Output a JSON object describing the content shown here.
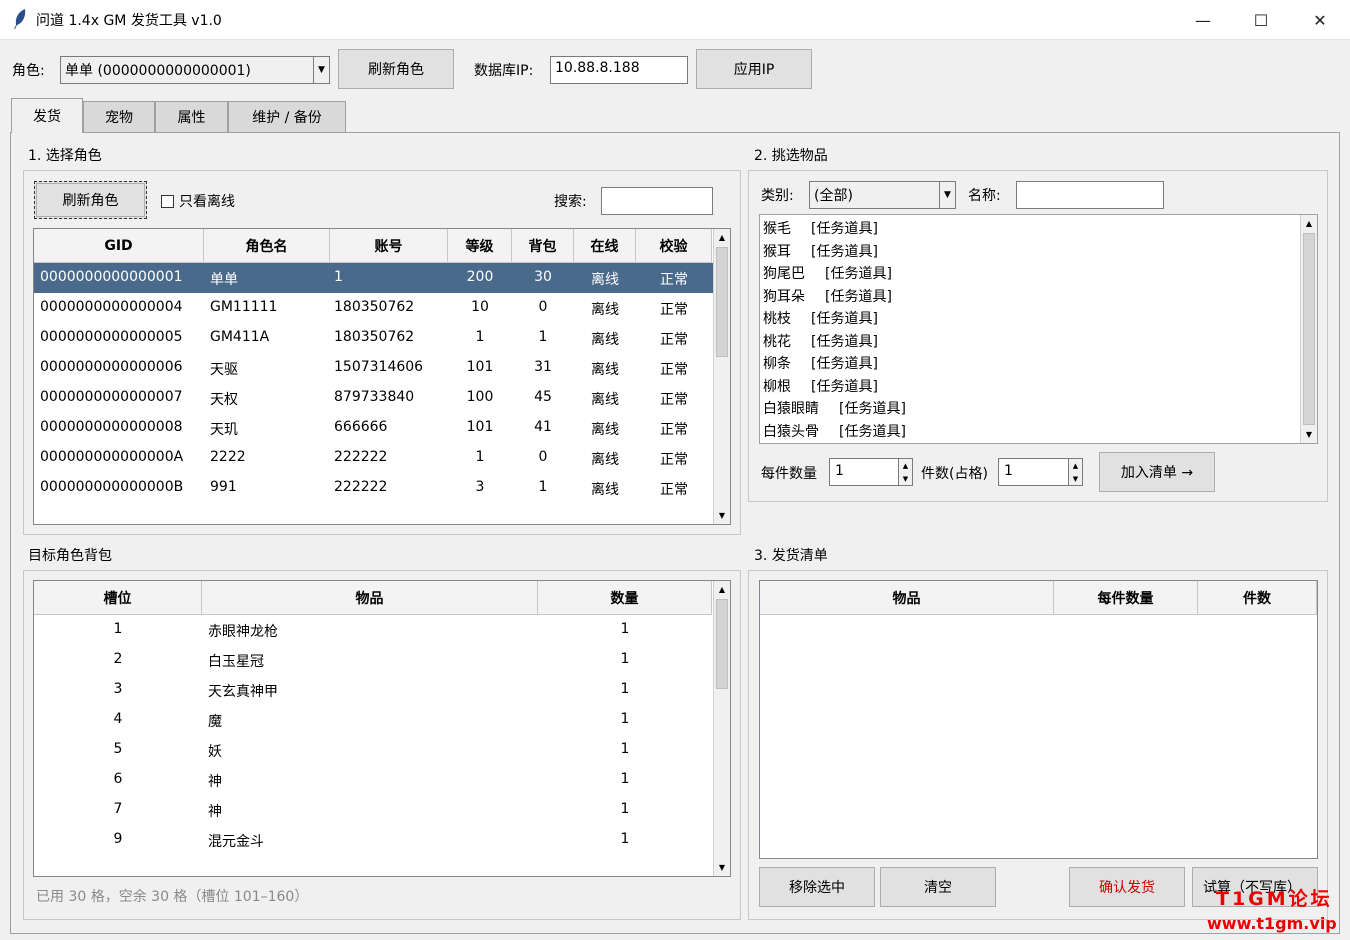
{
  "window": {
    "title": "问道 1.4x GM 发货工具  v1.0",
    "min": "—",
    "max": "☐",
    "close": "✕"
  },
  "top": {
    "role_label": "角色:",
    "role_value": "单单 (0000000000000001)",
    "refresh": "刷新角色",
    "db_label": "数据库IP:",
    "db_value": "10.88.8.188",
    "apply": "应用IP"
  },
  "tabs": [
    "发货",
    "宠物",
    "属性",
    "维护 / 备份"
  ],
  "sec1": {
    "title": "1. 选择角色",
    "refresh": "刷新角色",
    "offline_only": "只看离线",
    "search_label": "搜索:",
    "search_value": ""
  },
  "roles": {
    "headers": [
      "GID",
      "角色名",
      "账号",
      "等级",
      "背包",
      "在线",
      "校验"
    ],
    "rows": [
      [
        "0000000000000001",
        "单单",
        "1",
        "200",
        "30",
        "离线",
        "正常"
      ],
      [
        "0000000000000004",
        "GM11111",
        "180350762",
        "10",
        "0",
        "离线",
        "正常"
      ],
      [
        "0000000000000005",
        "GM411A",
        "180350762",
        "1",
        "1",
        "离线",
        "正常"
      ],
      [
        "0000000000000006",
        "天驱",
        "1507314606",
        "101",
        "31",
        "离线",
        "正常"
      ],
      [
        "0000000000000007",
        "天权",
        "879733840",
        "100",
        "45",
        "离线",
        "正常"
      ],
      [
        "0000000000000008",
        "天玑",
        "666666",
        "101",
        "41",
        "离线",
        "正常"
      ],
      [
        "000000000000000A",
        "2222",
        "222222",
        "1",
        "0",
        "离线",
        "正常"
      ],
      [
        "000000000000000B",
        "991",
        "222222",
        "3",
        "1",
        "离线",
        "正常"
      ]
    ]
  },
  "sec2": {
    "title": "2. 挑选物品",
    "cat_label": "类别:",
    "cat_value": "(全部)",
    "name_label": "名称:",
    "name_value": "",
    "qty_label": "每件数量",
    "qty_value": "1",
    "count_label": "件数(占格)",
    "count_value": "1",
    "add": "加入清单 →",
    "items": [
      [
        "猴毛",
        "[任务道具]"
      ],
      [
        "猴耳",
        "[任务道具]"
      ],
      [
        "狗尾巴",
        "[任务道具]"
      ],
      [
        "狗耳朵",
        "[任务道具]"
      ],
      [
        "桃枝",
        "[任务道具]"
      ],
      [
        "桃花",
        "[任务道具]"
      ],
      [
        "柳条",
        "[任务道具]"
      ],
      [
        "柳根",
        "[任务道具]"
      ],
      [
        "白猿眼睛",
        "[任务道具]"
      ],
      [
        "白猿头骨",
        "[任务道具]"
      ]
    ]
  },
  "bag": {
    "title": "目标角色背包",
    "headers": [
      "槽位",
      "物品",
      "数量"
    ],
    "rows": [
      [
        "1",
        "赤眼神龙枪",
        "1"
      ],
      [
        "2",
        "白玉星冠",
        "1"
      ],
      [
        "3",
        "天玄真神甲",
        "1"
      ],
      [
        "4",
        "魔",
        "1"
      ],
      [
        "5",
        "妖",
        "1"
      ],
      [
        "6",
        "神",
        "1"
      ],
      [
        "7",
        "神",
        "1"
      ],
      [
        "9",
        "混元金斗",
        "1"
      ]
    ],
    "status": "已用 30 格，空余 30 格（槽位 101–160）"
  },
  "sec3": {
    "title": "3. 发货清单",
    "headers": [
      "物品",
      "每件数量",
      "件数"
    ],
    "remove": "移除选中",
    "clear": "清空",
    "confirm": "确认发货",
    "trial": "试算（不写库）"
  },
  "watermark": {
    "line1": "T1GM论坛",
    "line2": "www.t1gm.vip"
  },
  "colors": {
    "selection": "#4a6a8c",
    "confirm_text": "#cc0000",
    "watermark": "#e00000"
  }
}
